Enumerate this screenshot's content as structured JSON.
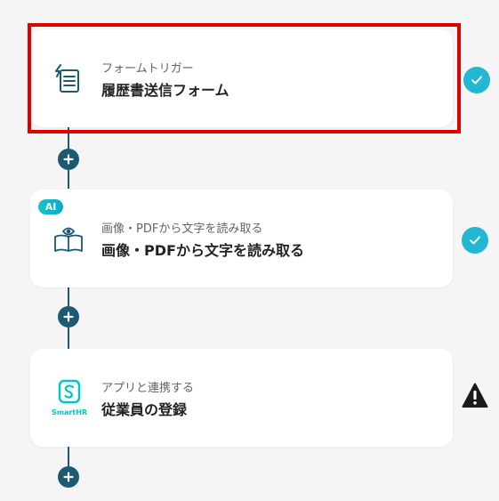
{
  "steps": [
    {
      "subtitle": "フォームトリガー",
      "title": "履歴書送信フォーム",
      "icon": "form-trigger-icon",
      "status": "check-icon"
    },
    {
      "badge": "AI",
      "subtitle": "画像・PDFから文字を読み取る",
      "title": "画像・PDFから文字を読み取る",
      "icon": "book-eye-icon",
      "status": "check-icon"
    },
    {
      "subtitle": "アプリと連携する",
      "title": "従業員の登録",
      "icon": "smarthr-logo-icon",
      "logo_text": "SmartHR",
      "status": "warning-icon"
    }
  ],
  "colors": {
    "accent": "#1c5a72",
    "check": "#23b7d3",
    "highlight": "#e00000",
    "smarthr": "#00c4cc"
  }
}
